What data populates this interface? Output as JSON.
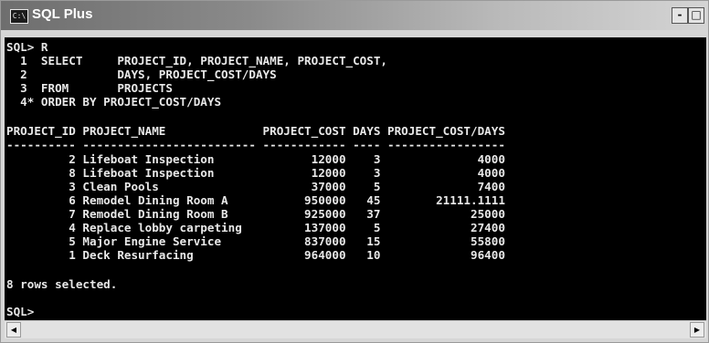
{
  "window": {
    "title": "SQL Plus",
    "app_icon": "C:\\",
    "minimize": "-",
    "maximize": "□"
  },
  "console_lines": [
    "SQL> R",
    "  1  SELECT     PROJECT_ID, PROJECT_NAME, PROJECT_COST,",
    "  2             DAYS, PROJECT_COST/DAYS",
    "  3  FROM       PROJECTS",
    "  4* ORDER BY PROJECT_COST/DAYS",
    "",
    "PROJECT_ID PROJECT_NAME              PROJECT_COST DAYS PROJECT_COST/DAYS",
    "---------- ------------------------- ------------ ---- -----------------",
    "         2 Lifeboat Inspection              12000    3              4000",
    "         8 Lifeboat Inspection              12000    3              4000",
    "         3 Clean Pools                      37000    5              7400",
    "         6 Remodel Dining Room A           950000   45        21111.1111",
    "         7 Remodel Dining Room B           925000   37             25000",
    "         4 Replace lobby carpeting         137000    5             27400",
    "         5 Major Engine Service            837000   15             55800",
    "         1 Deck Resurfacing                964000   10             96400",
    "",
    "8 rows selected.",
    "",
    "SQL>"
  ],
  "scrollbar": {
    "left_arrow": "◀",
    "right_arrow": "▶"
  }
}
